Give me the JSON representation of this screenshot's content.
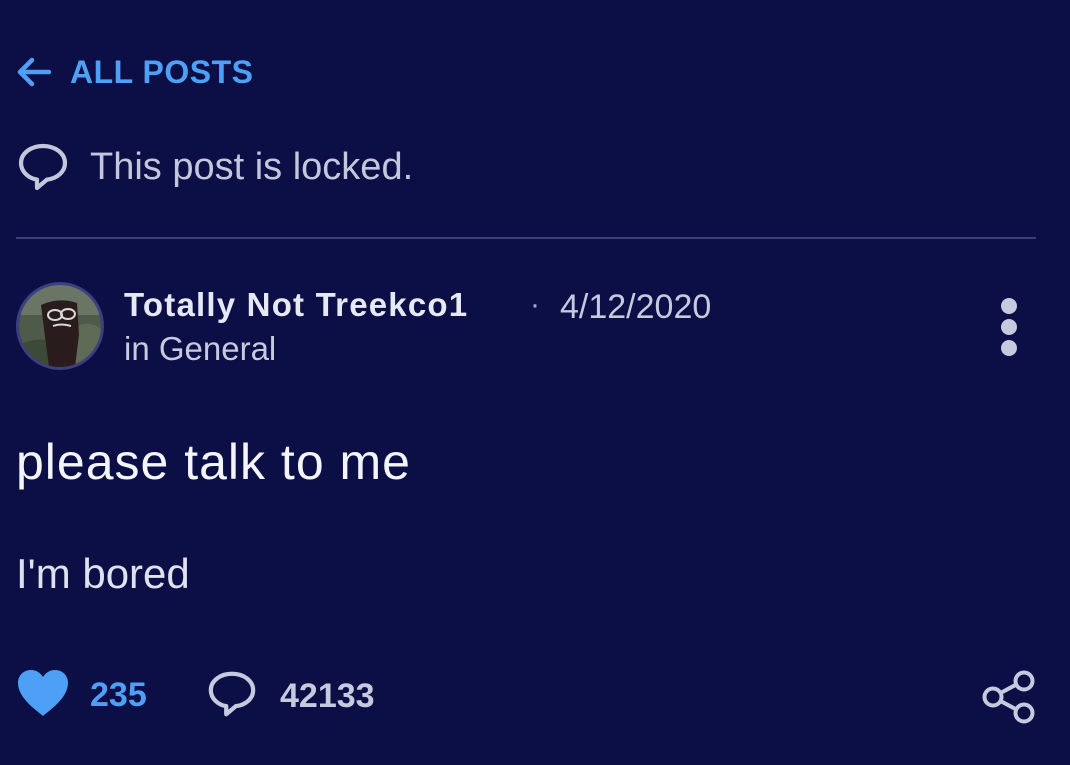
{
  "nav": {
    "back_label": "ALL POSTS",
    "back_icon": "arrow-left-icon"
  },
  "notice": {
    "text": "This post is locked.",
    "icon": "speech-bubble-icon"
  },
  "post": {
    "author": "Totally Not Treekco1",
    "separator": "·",
    "date": "4/12/2020",
    "category": "in General",
    "title": "please talk to me",
    "body": "I'm bored",
    "likes": "235",
    "comments": "42133"
  },
  "colors": {
    "background": "#0b0f46",
    "accent": "#4da0f5",
    "muted": "#c7c9de",
    "divider": "#3a3f78"
  }
}
